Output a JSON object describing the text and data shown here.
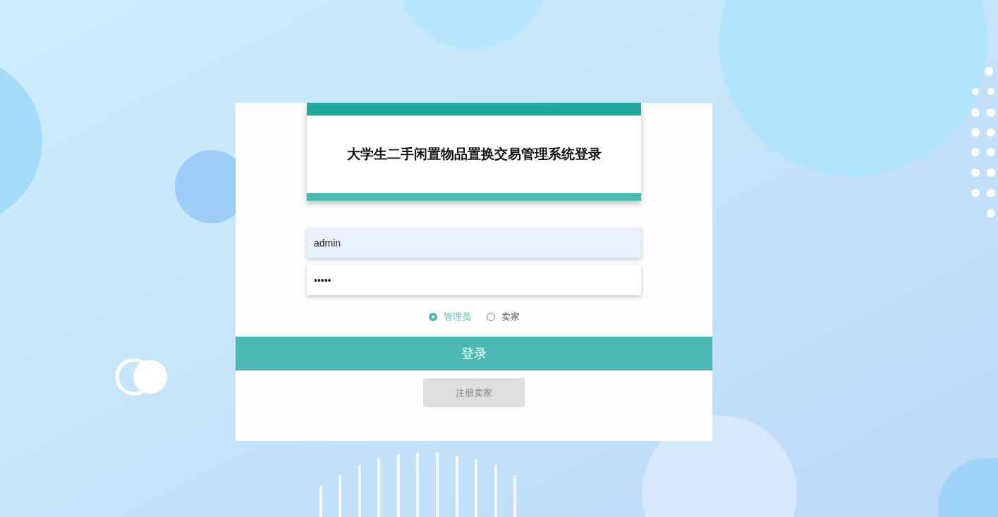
{
  "header": {
    "title": "大学生二手闲置物品置换交易管理系统登录"
  },
  "username": {
    "value": "admin"
  },
  "password": {
    "value": "•••••"
  },
  "roles": [
    {
      "label": "管理员",
      "selected": true
    },
    {
      "label": "卖家",
      "selected": false
    }
  ],
  "login_button": "登录",
  "register_button": "注册卖家"
}
